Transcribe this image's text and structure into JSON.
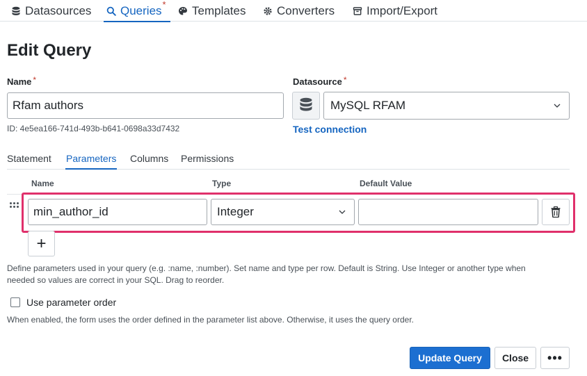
{
  "nav": {
    "items": [
      {
        "label": "Datasources",
        "icon": "database-icon"
      },
      {
        "label": "Queries",
        "icon": "search-icon",
        "modified": "*"
      },
      {
        "label": "Templates",
        "icon": "palette-icon"
      },
      {
        "label": "Converters",
        "icon": "gears-icon"
      },
      {
        "label": "Import/Export",
        "icon": "archive-icon"
      }
    ],
    "active": "Queries"
  },
  "page": {
    "title": "Edit Query"
  },
  "form": {
    "name_label": "Name",
    "required_mark": "*",
    "name_value": "Rfam authors",
    "id_text": "ID: 4e5ea166-741d-493b-b641-0698a33d7432",
    "datasource_label": "Datasource",
    "datasource_value": "MySQL RFAM",
    "test_connection": "Test connection"
  },
  "tabs": [
    {
      "label": "Statement"
    },
    {
      "label": "Parameters"
    },
    {
      "label": "Columns"
    },
    {
      "label": "Permissions"
    }
  ],
  "active_tab": "Parameters",
  "params": {
    "headers": {
      "name": "Name",
      "type": "Type",
      "default": "Default Value"
    },
    "rows": [
      {
        "name": "min_author_id",
        "type": "Integer",
        "default": ""
      }
    ],
    "add_label": "+",
    "help_line1": "Define parameters used in your query (e.g. :name, :number). Set name and type per row. Default is String. Use Integer or another type when",
    "help_line2": "needed so values are correct in your SQL. Drag to reorder.",
    "order_label": "Use parameter order",
    "order_checked": false,
    "order_help": "When enabled, the form uses the order defined in the parameter list above. Otherwise, it uses the query order."
  },
  "actions": {
    "update": "Update Query",
    "close": "Close",
    "more": "•••"
  },
  "colors": {
    "accent": "#1565c0",
    "highlight": "#e0306b",
    "primary_button": "#1c6fd1",
    "required": "#c0392b"
  }
}
